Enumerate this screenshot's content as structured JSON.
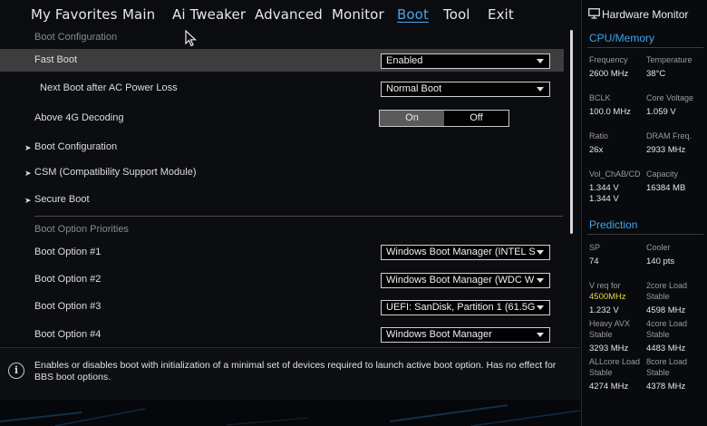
{
  "nav": {
    "items": [
      {
        "label": "My Favorites"
      },
      {
        "label": "Main"
      },
      {
        "label": "Ai Tweaker"
      },
      {
        "label": "Advanced"
      },
      {
        "label": "Monitor"
      },
      {
        "label": "Boot"
      },
      {
        "label": "Tool"
      },
      {
        "label": "Exit"
      }
    ],
    "active": "Boot"
  },
  "main": {
    "section_boot_config": "Boot Configuration",
    "fast_boot": {
      "label": "Fast Boot",
      "value": "Enabled"
    },
    "next_boot": {
      "label": "Next Boot after AC Power Loss",
      "value": "Normal Boot"
    },
    "above4g": {
      "label": "Above 4G Decoding",
      "on": "On",
      "off": "Off",
      "selected": "On"
    },
    "submenus": [
      {
        "label": "Boot Configuration"
      },
      {
        "label": "CSM (Compatibility Support Module)"
      },
      {
        "label": "Secure Boot"
      }
    ],
    "section_priorities": "Boot Option Priorities",
    "boot_options": [
      {
        "label": "Boot Option #1",
        "value": "Windows Boot Manager (INTEL S"
      },
      {
        "label": "Boot Option #2",
        "value": "Windows Boot Manager (WDC W"
      },
      {
        "label": "Boot Option #3",
        "value": "UEFI: SanDisk, Partition 1 (61.5G"
      },
      {
        "label": "Boot Option #4",
        "value": "Windows Boot Manager"
      }
    ]
  },
  "help": {
    "text": "Enables or disables boot with initialization of a minimal set of devices required to launch active boot option. Has no effect for BBS boot options."
  },
  "hw": {
    "title": "Hardware Monitor",
    "cpu_memory": "CPU/Memory",
    "frequency": {
      "label": "Frequency",
      "value": "2600 MHz"
    },
    "temperature": {
      "label": "Temperature",
      "value": "38°C"
    },
    "bclk": {
      "label": "BCLK",
      "value": "100.0 MHz"
    },
    "core_voltage": {
      "label": "Core Voltage",
      "value": "1.059 V"
    },
    "ratio": {
      "label": "Ratio",
      "value": "26x"
    },
    "dram_freq": {
      "label": "DRAM Freq.",
      "value": "2933 MHz"
    },
    "vol_chab": {
      "label": "Vol_ChAB/CD",
      "value1": "1.344 V",
      "value2": "1.344 V"
    },
    "capacity": {
      "label": "Capacity",
      "value": "16384 MB"
    },
    "prediction": "Prediction",
    "sp": {
      "label": "SP",
      "value": "74"
    },
    "cooler": {
      "label": "Cooler",
      "value": "140 pts"
    },
    "vreq": {
      "label": "V req for",
      "freq": "4500MHz",
      "value": "1.232 V"
    },
    "twocore": {
      "label1": "2core Load",
      "label2": "Stable",
      "value": "4598 MHz"
    },
    "heavy_avx": {
      "label1": "Heavy AVX",
      "label2": "Stable",
      "value": "3293 MHz"
    },
    "fourcore": {
      "label1": "4core Load",
      "label2": "Stable",
      "value": "4483 MHz"
    },
    "allcore": {
      "label1": "ALLcore Load",
      "label2": "Stable",
      "value": "4274 MHz"
    },
    "eightcore": {
      "label1": "8core Load",
      "label2": "Stable",
      "value": "4378 MHz"
    },
    "accent_color": "#3fa6ea",
    "highlight_color": "#e8d64a"
  },
  "theme": {
    "active_nav_color": "#4aa7e6",
    "highlight_row_bg": "#3d3d3d"
  }
}
